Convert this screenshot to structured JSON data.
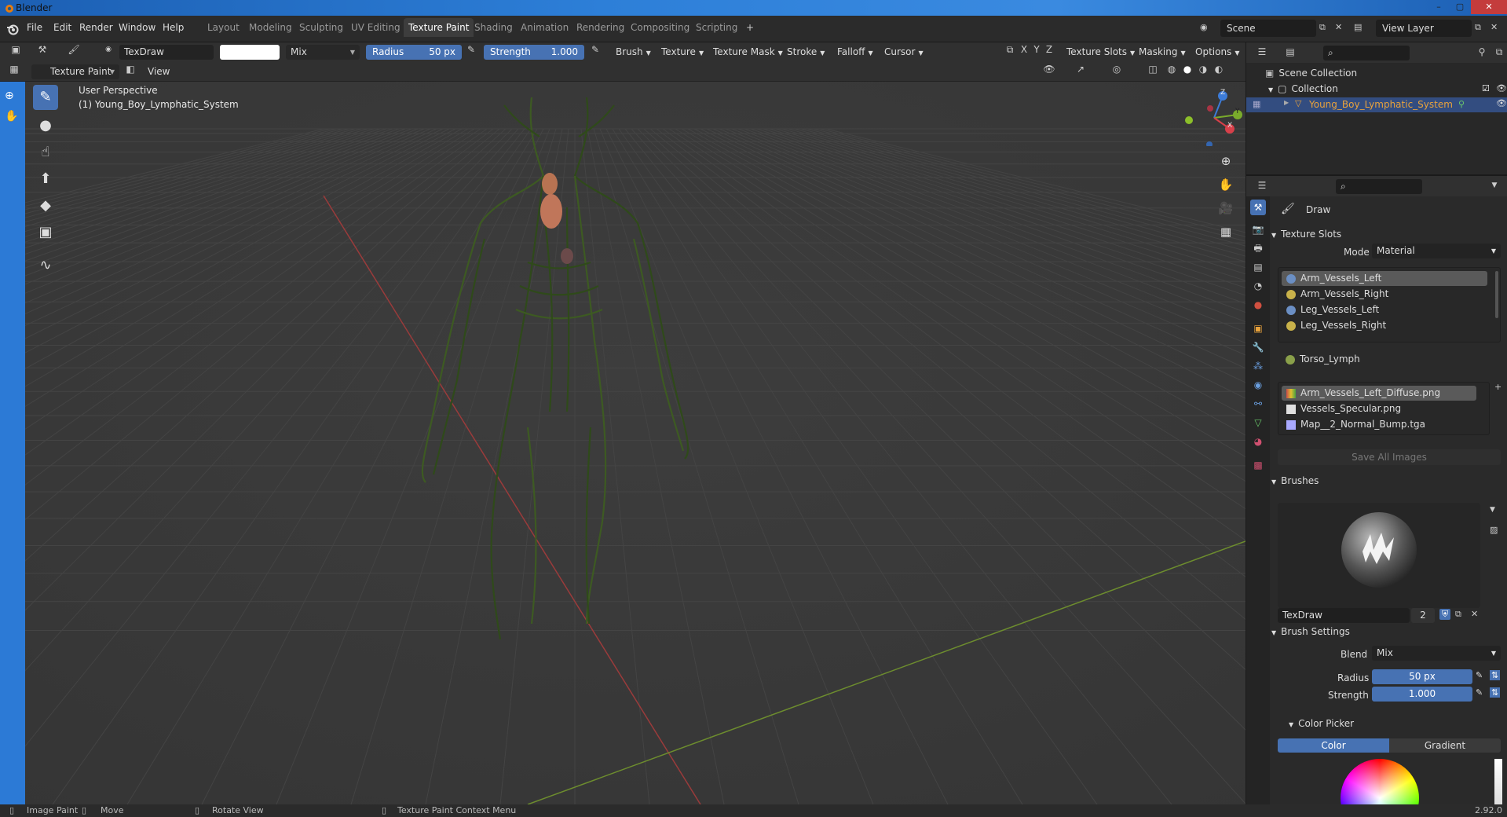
{
  "window": {
    "title": "Blender"
  },
  "menu": [
    "File",
    "Edit",
    "Render",
    "Window",
    "Help"
  ],
  "workspaces": [
    "Layout",
    "Modeling",
    "Sculpting",
    "UV Editing",
    "Texture Paint",
    "Shading",
    "Animation",
    "Rendering",
    "Compositing",
    "Scripting"
  ],
  "active_workspace": "Texture Paint",
  "add_workspace": "+",
  "scene": "Scene",
  "view_layer": "View Layer",
  "tool_header": {
    "brush_name": "TexDraw",
    "blend": "Mix",
    "radius_label": "Radius",
    "radius_value": "50 px",
    "strength_label": "Strength",
    "strength_value": "1.000",
    "menus": [
      "Brush",
      "Texture",
      "Texture Mask",
      "Stroke",
      "Falloff",
      "Cursor"
    ],
    "axes": [
      "X",
      "Y",
      "Z"
    ],
    "right_menus": [
      "Texture Slots",
      "Masking",
      "Options"
    ]
  },
  "mode_header": {
    "mode": "Texture Paint",
    "view": "View"
  },
  "viewport": {
    "perspective": "User Perspective",
    "object_label": "(1) Young_Boy_Lymphatic_System",
    "gizmo_axes": [
      "Z",
      "Y",
      "X"
    ]
  },
  "outliner": {
    "scene_collection": "Scene Collection",
    "collection": "Collection",
    "object": "Young_Boy_Lymphatic_System"
  },
  "properties": {
    "tool_name": "Draw",
    "texture_slots_header": "Texture Slots",
    "mode_label": "Mode",
    "mode_value": "Material",
    "materials": [
      {
        "name": "Arm_Vessels_Left",
        "color": "#6b8fc4"
      },
      {
        "name": "Arm_Vessels_Right",
        "color": "#c9b24a"
      },
      {
        "name": "Leg_Vessels_Left",
        "color": "#6b8fc4"
      },
      {
        "name": "Leg_Vessels_Right",
        "color": "#c9b24a"
      },
      {
        "name": "Torso_Lymph",
        "color": "#8aa04a"
      }
    ],
    "images": [
      {
        "name": "Arm_Vessels_Left_Diffuse.png",
        "color": "#c94a4a"
      },
      {
        "name": "Vessels_Specular.png",
        "color": "#e0e0e0"
      },
      {
        "name": "Map__2_Normal_Bump.tga",
        "color": "#a9a9ff"
      }
    ],
    "save_all_images": "Save All Images",
    "brushes_header": "Brushes",
    "brush_name": "TexDraw",
    "brush_users": "2",
    "brush_settings_header": "Brush Settings",
    "blend_label": "Blend",
    "blend_value": "Mix",
    "radius_label": "Radius",
    "radius_value": "50 px",
    "strength_label": "Strength",
    "strength_value": "1.000",
    "color_picker_header": "Color Picker",
    "color_tab": "Color",
    "gradient_tab": "Gradient"
  },
  "statusbar": {
    "image_paint": "Image Paint",
    "move": "Move",
    "rotate_view": "Rotate View",
    "context_menu": "Texture Paint Context Menu",
    "version": "2.92.0"
  }
}
